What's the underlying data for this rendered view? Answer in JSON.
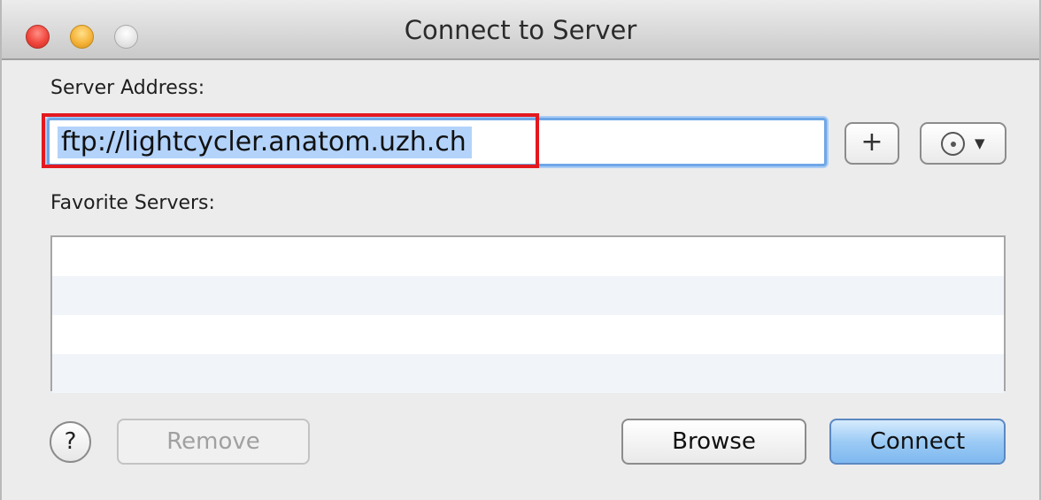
{
  "window": {
    "title": "Connect to Server"
  },
  "server_address": {
    "label": "Server Address:",
    "value": "ftp://lightcycler.anatom.uzh.ch"
  },
  "buttons": {
    "add": "+",
    "action_icon": "action-gear-icon",
    "help": "?",
    "remove": "Remove",
    "browse": "Browse",
    "connect": "Connect"
  },
  "favorites": {
    "label": "Favorite Servers:",
    "items": []
  },
  "colors": {
    "selection_highlight": "#b3d3fb",
    "annotation_box": "#e2191e",
    "default_button": "#9ccbf5"
  }
}
